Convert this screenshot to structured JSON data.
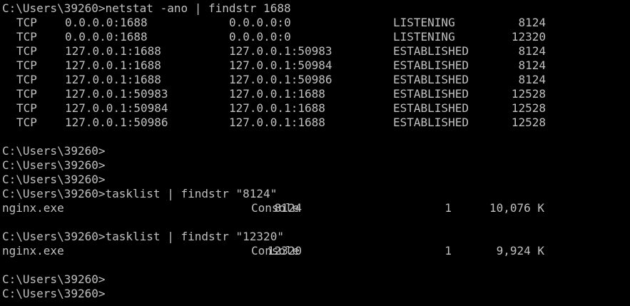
{
  "window": {
    "type": "command-prompt",
    "background": "#000000",
    "text_color": "#c0c0c0"
  },
  "prompt": "C:\\Users\\39260>",
  "commands": {
    "netstat": "netstat -ano | findstr 1688",
    "tasklist_8124": "tasklist | findstr \"8124\"",
    "tasklist_12320": "tasklist | findstr \"12320\""
  },
  "netstat_rows": [
    {
      "proto": "TCP",
      "local": "0.0.0.0:1688",
      "foreign": "0.0.0.0:0",
      "state": "LISTENING",
      "pid": "8124"
    },
    {
      "proto": "TCP",
      "local": "0.0.0.0:1688",
      "foreign": "0.0.0.0:0",
      "state": "LISTENING",
      "pid": "12320"
    },
    {
      "proto": "TCP",
      "local": "127.0.0.1:1688",
      "foreign": "127.0.0.1:50983",
      "state": "ESTABLISHED",
      "pid": "8124"
    },
    {
      "proto": "TCP",
      "local": "127.0.0.1:1688",
      "foreign": "127.0.0.1:50984",
      "state": "ESTABLISHED",
      "pid": "8124"
    },
    {
      "proto": "TCP",
      "local": "127.0.0.1:1688",
      "foreign": "127.0.0.1:50986",
      "state": "ESTABLISHED",
      "pid": "8124"
    },
    {
      "proto": "TCP",
      "local": "127.0.0.1:50983",
      "foreign": "127.0.0.1:1688",
      "state": "ESTABLISHED",
      "pid": "12528"
    },
    {
      "proto": "TCP",
      "local": "127.0.0.1:50984",
      "foreign": "127.0.0.1:1688",
      "state": "ESTABLISHED",
      "pid": "12528"
    },
    {
      "proto": "TCP",
      "local": "127.0.0.1:50986",
      "foreign": "127.0.0.1:1688",
      "state": "ESTABLISHED",
      "pid": "12528"
    }
  ],
  "tasklist_results": [
    {
      "image": "nginx.exe",
      "pid": "8124",
      "session_name": "Console",
      "session_num": "1",
      "mem": "10,076 K"
    },
    {
      "image": "nginx.exe",
      "pid": "12320",
      "session_name": "Console",
      "session_num": "1",
      "mem": "9,924 K"
    }
  ]
}
